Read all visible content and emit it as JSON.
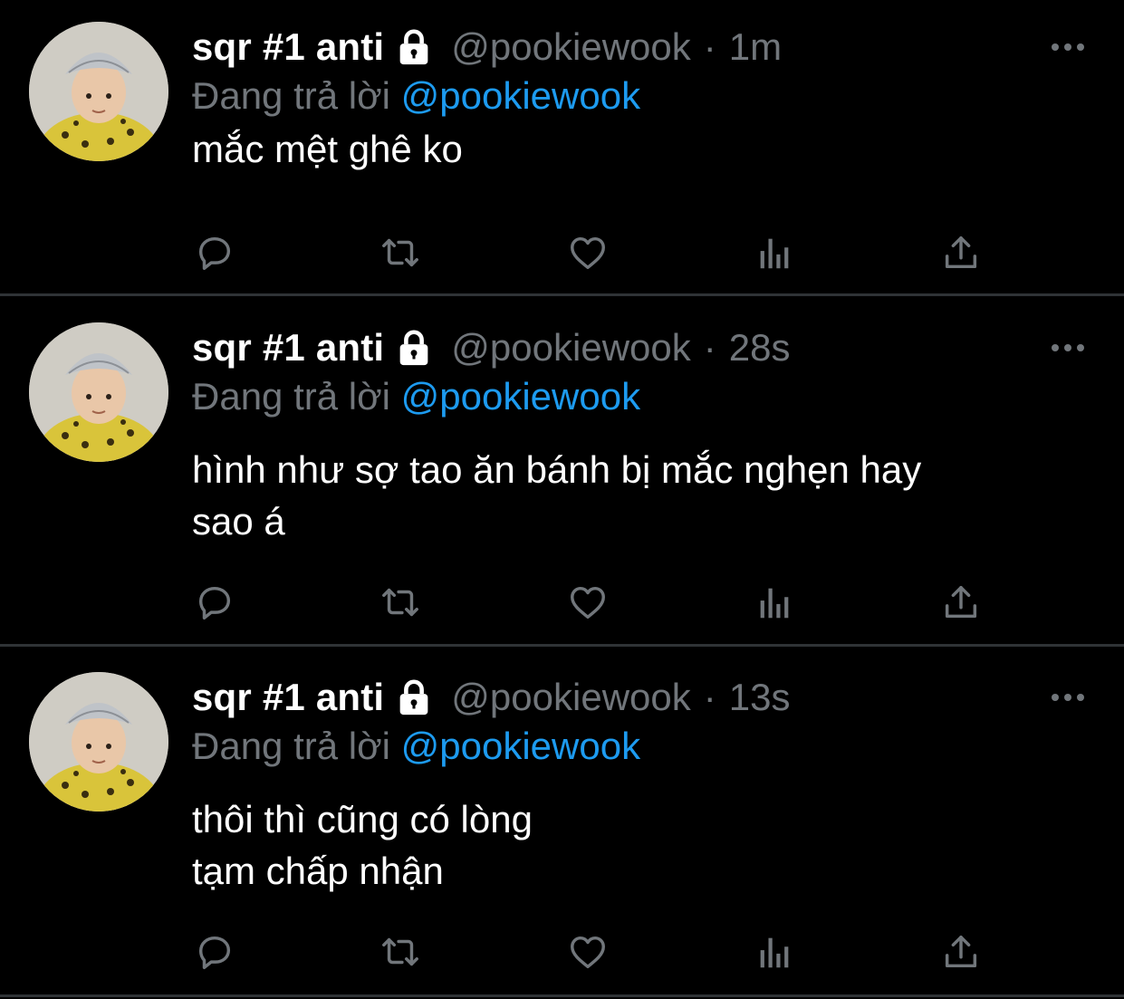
{
  "tweets": [
    {
      "name": "sqr #1 anti",
      "handle": "@pookiewook",
      "separator": "·",
      "time": "1m",
      "reply_prefix": "Đang trả lời",
      "reply_to": "@pookiewook",
      "lines": [
        "mắc mệt ghê ko"
      ]
    },
    {
      "name": "sqr #1 anti",
      "handle": "@pookiewook",
      "separator": "·",
      "time": "28s",
      "reply_prefix": "Đang trả lời",
      "reply_to": "@pookiewook",
      "lines": [
        "hình như sợ tao ăn bánh bị mắc nghẹn hay",
        "sao á"
      ]
    },
    {
      "name": "sqr #1 anti",
      "handle": "@pookiewook",
      "separator": "·",
      "time": "13s",
      "reply_prefix": "Đang trả lời",
      "reply_to": "@pookiewook",
      "lines": [
        "thôi thì cũng có lòng",
        "tạm chấp nhận"
      ]
    }
  ],
  "icons": {
    "lock": "lock-icon",
    "more": "more-icon",
    "reply": "reply-icon",
    "retweet": "retweet-icon",
    "like": "like-icon",
    "views": "views-icon",
    "share": "share-icon"
  },
  "colors": {
    "background": "#000000",
    "text": "#ffffff",
    "secondary": "#71767b",
    "mention": "#1d9bf0",
    "divider": "#2f3336"
  }
}
